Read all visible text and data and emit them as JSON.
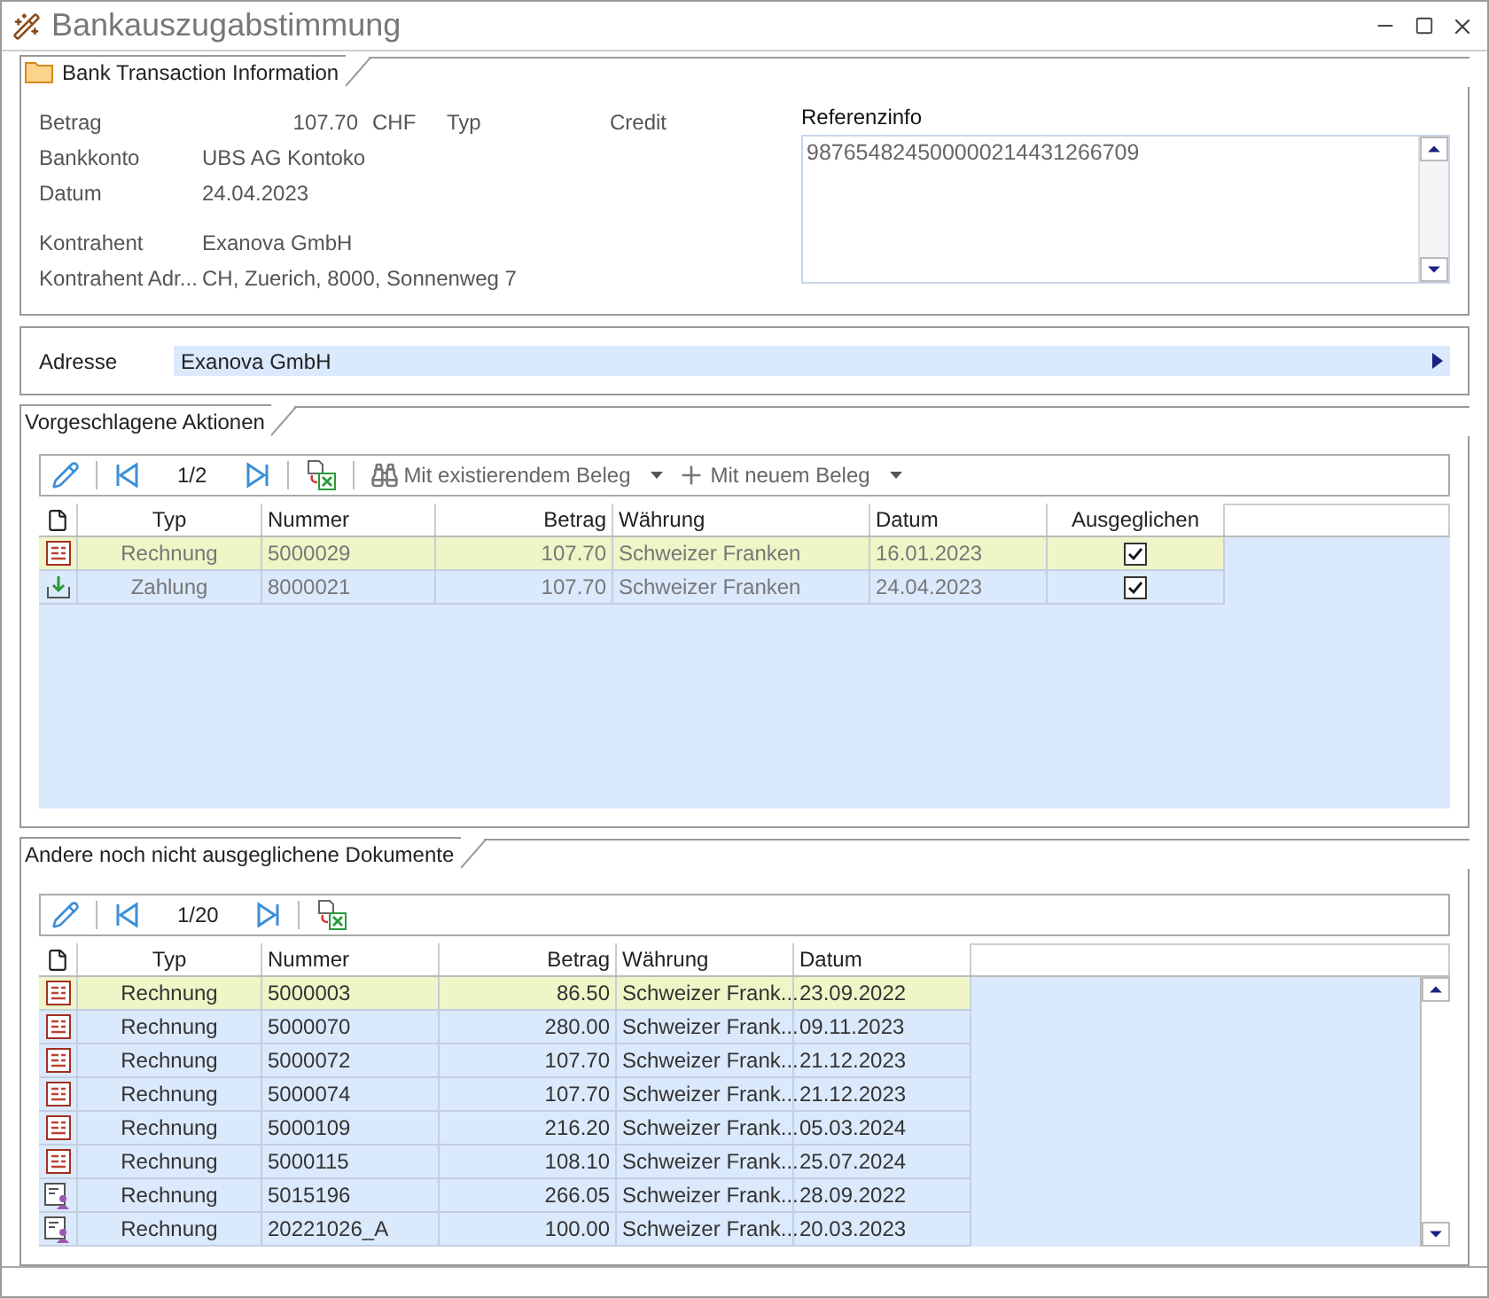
{
  "window": {
    "title": "Bankauszugabstimmung"
  },
  "transaction": {
    "tab": "Bank Transaction Information",
    "amount": {
      "label": "Betrag",
      "value": "107.70",
      "currency": "CHF"
    },
    "type": {
      "label": "Typ",
      "value": "Credit"
    },
    "field_groups": [
      [
        {
          "label": "Bankkonto",
          "value": "UBS AG Kontoko"
        },
        {
          "label": "Datum",
          "value": "24.04.2023"
        }
      ],
      [
        {
          "label": "Kontrahent",
          "value": "Exanova GmbH"
        },
        {
          "label": "Kontrahent Adr...",
          "value": "CH, Zuerich, 8000, Sonnenweg 7"
        }
      ]
    ],
    "reference": {
      "label": "Referenzinfo",
      "value": "987654824500000214431266709"
    }
  },
  "address": {
    "label": "Adresse",
    "value": "Exanova GmbH"
  },
  "suggested": {
    "tab": "Vorgeschlagene Aktionen",
    "page": "1/2",
    "actions": [
      "Mit existierendem Beleg",
      "Mit neuem Beleg"
    ],
    "columns": [
      "Typ",
      "Nummer",
      "Betrag",
      "Währung",
      "Datum",
      "Ausgeglichen"
    ],
    "rows": [
      {
        "kind": "invoice",
        "typ": "Rechnung",
        "nummer": "5000029",
        "betrag": "107.70",
        "waehrung": "Schweizer Franken",
        "datum": "16.01.2023",
        "checked": true,
        "selected": true
      },
      {
        "kind": "payment",
        "typ": "Zahlung",
        "nummer": "8000021",
        "betrag": "107.70",
        "waehrung": "Schweizer Franken",
        "datum": "24.04.2023",
        "checked": true,
        "selected": false
      }
    ]
  },
  "others": {
    "tab": "Andere noch nicht ausgeglichene Dokumente",
    "page": "1/20",
    "columns": [
      "Typ",
      "Nummer",
      "Betrag",
      "Währung",
      "Datum"
    ],
    "rows": [
      {
        "kind": "invoice",
        "typ": "Rechnung",
        "nummer": "5000003",
        "betrag": "86.50",
        "waehrung": "Schweizer Frank...",
        "datum": "23.09.2022",
        "selected": true
      },
      {
        "kind": "invoice",
        "typ": "Rechnung",
        "nummer": "5000070",
        "betrag": "280.00",
        "waehrung": "Schweizer Frank...",
        "datum": "09.11.2023",
        "selected": false
      },
      {
        "kind": "invoice",
        "typ": "Rechnung",
        "nummer": "5000072",
        "betrag": "107.70",
        "waehrung": "Schweizer Frank...",
        "datum": "21.12.2023",
        "selected": false
      },
      {
        "kind": "invoice",
        "typ": "Rechnung",
        "nummer": "5000074",
        "betrag": "107.70",
        "waehrung": "Schweizer Frank...",
        "datum": "21.12.2023",
        "selected": false
      },
      {
        "kind": "invoice",
        "typ": "Rechnung",
        "nummer": "5000109",
        "betrag": "216.20",
        "waehrung": "Schweizer Frank...",
        "datum": "05.03.2024",
        "selected": false
      },
      {
        "kind": "invoice",
        "typ": "Rechnung",
        "nummer": "5000115",
        "betrag": "108.10",
        "waehrung": "Schweizer Frank...",
        "datum": "25.07.2024",
        "selected": false
      },
      {
        "kind": "person-invoice",
        "typ": "Rechnung",
        "nummer": "5015196",
        "betrag": "266.05",
        "waehrung": "Schweizer Frank...",
        "datum": "28.09.2022",
        "selected": false
      },
      {
        "kind": "person-invoice",
        "typ": "Rechnung",
        "nummer": "20221026_A",
        "betrag": "100.00",
        "waehrung": "Schweizer Frank...",
        "datum": "20.03.2023",
        "selected": false
      }
    ]
  }
}
